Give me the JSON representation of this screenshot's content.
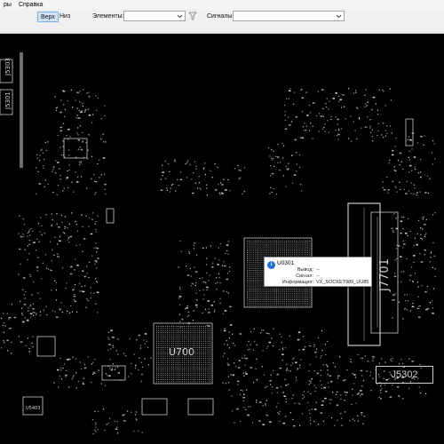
{
  "menu": {
    "items": [
      "ры",
      "Справка"
    ]
  },
  "toolbar": {
    "side_top": "Верх",
    "side_bottom": "Низ",
    "elements_label": "Элементы:",
    "elements_value": "",
    "signals_label": "Сигналы:",
    "signals_value": "",
    "filter_icon": "funnel-icon"
  },
  "board": {
    "labels": {
      "j7701": "J7701",
      "u700": "U700",
      "j5302": "J5302",
      "j5303": "J5303",
      "j5301": "J5301",
      "u5403": "U5403"
    }
  },
  "tooltip": {
    "icon": "info-icon",
    "title": "U0301",
    "rows": [
      {
        "key": "Вывод:",
        "value": "--"
      },
      {
        "key": "Сигнал:",
        "value": "--"
      },
      {
        "key": "Информация:",
        "value": "VX_SOCKET989_UU85"
      }
    ]
  },
  "colors": {
    "board_bg": "#000000",
    "silkscreen": "#c8c8c8",
    "pads": "#8fa3a3",
    "toolbar_bg": "#f0f0f0",
    "active_side": "#cfe3f7",
    "info_icon": "#1f6fd1"
  }
}
